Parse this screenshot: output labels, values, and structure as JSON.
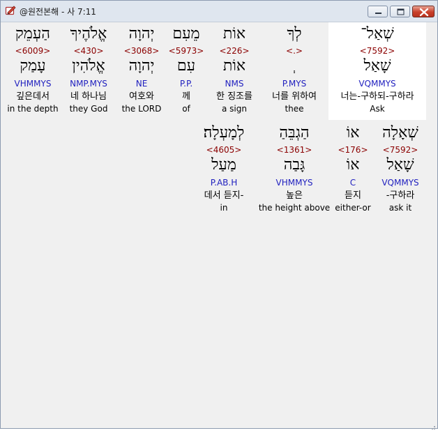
{
  "window": {
    "title": "@원전본해 - 사 7:11"
  },
  "icons": {
    "app": "bible-app-icon",
    "minimize": "minimize-icon",
    "maximize": "maximize-icon",
    "close": "close-icon"
  },
  "colors": {
    "strong": "#8b0000",
    "morph": "#1f1fbf",
    "selected_bg": "#ffffff"
  },
  "row1": [
    {
      "hebrew": "הַעְמֵק",
      "strong": "<6009>",
      "lemma": "עָמַק",
      "morph": "VHMMYS",
      "korean": "깊은데서",
      "english": "in the depth"
    },
    {
      "hebrew": "אֱלֹהֶיךָ",
      "strong": "<430>",
      "lemma": "אֱלֹהִין",
      "morph": "NMP.MYS",
      "korean": "네 하나님",
      "english": "they God"
    },
    {
      "hebrew": "יְהוָה",
      "strong": "<3068>",
      "lemma": "יְהוָה",
      "morph": "NE",
      "korean": "여호와",
      "english": "the LORD"
    },
    {
      "hebrew": "מֵעִם",
      "strong": "<5973>",
      "lemma": "עִם",
      "morph": "P.P.",
      "korean": "께",
      "english": "of"
    },
    {
      "hebrew": "אוֹת",
      "strong": "<226>",
      "lemma": "אוֹת",
      "morph": "NMS",
      "korean": "한 징조를",
      "english": "a sign"
    },
    {
      "hebrew": "לְךָ",
      "strong": "<.>",
      "lemma": "ְ",
      "morph": "P.MYS",
      "korean": "너를 위하여",
      "english": "thee"
    },
    {
      "hebrew": "שְׁאַל־",
      "strong": "<7592>",
      "lemma": "שָׁאַל",
      "morph": "VQMMYS",
      "korean": "너는-구하되-구하라",
      "english": "Ask"
    }
  ],
  "row2": [
    {
      "hebrew": "לְמָעְלָה׃",
      "strong": "<4605>",
      "lemma": "מַעַל",
      "morph": "P.AB.H",
      "korean": "데서 듣지-",
      "english": "in"
    },
    {
      "hebrew": "הַגְבֵּהַ",
      "strong": "<1361>",
      "lemma": "גָּבַה",
      "morph": "VHMMYS",
      "korean": "높은",
      "english": "the height above"
    },
    {
      "hebrew": "אוֹ",
      "strong": "<176>",
      "lemma": "אוֹ",
      "morph": "C",
      "korean": "듣지",
      "english": "either-or"
    },
    {
      "hebrew": "שְׁאָלָה",
      "strong": "<7592>",
      "lemma": "שָׁאַל",
      "morph": "VQMMYS",
      "korean": "-구하라",
      "english": "ask it"
    }
  ]
}
